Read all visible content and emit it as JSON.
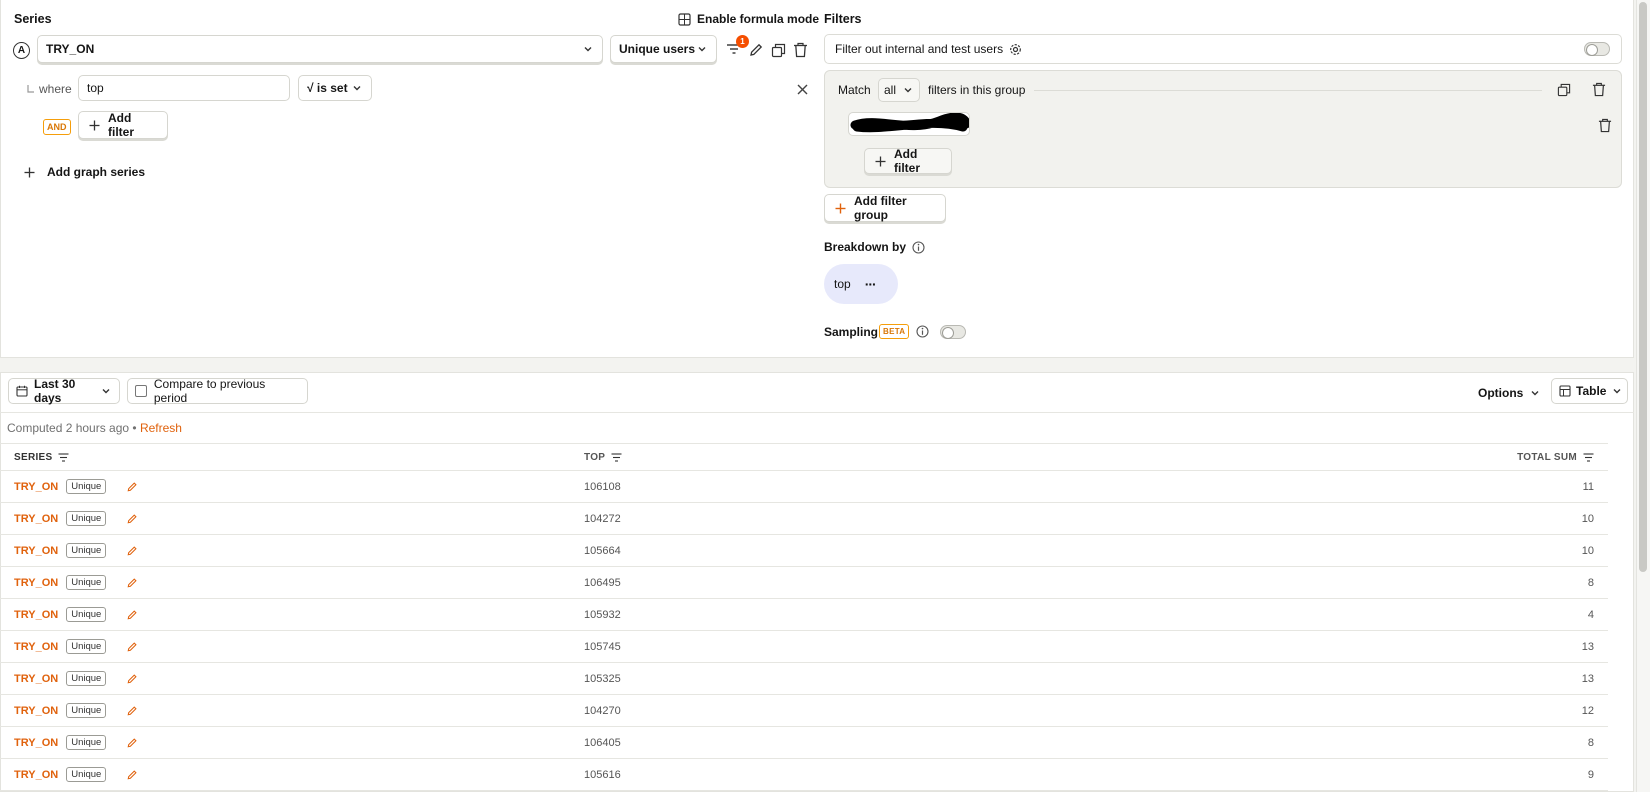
{
  "series_panel": {
    "title": "Series",
    "formula_label": "Enable formula mode",
    "series_letter": "A",
    "event_name": "TRY_ON",
    "aggregation": "Unique users",
    "filter_count_badge": "1",
    "where_label": "where",
    "filter_property": "top",
    "filter_operator": "√ is set",
    "and_badge": "AND",
    "add_filter": "Add filter",
    "add_graph_series": "Add graph series"
  },
  "filters_panel": {
    "title": "Filters",
    "filter_internal_label": "Filter out internal and test users",
    "match_label": "Match",
    "match_value": "all",
    "match_suffix": "filters in this group",
    "add_filter": "Add filter",
    "add_filter_group": "Add filter group",
    "breakdown_title": "Breakdown by",
    "breakdown_value": "top",
    "breakdown_more": "···",
    "sampling_title": "Sampling",
    "sampling_badge": "BETA"
  },
  "results_toolbar": {
    "date_range": "Last 30 days",
    "compare_label": "Compare to previous period",
    "options_label": "Options",
    "view_label": "Table",
    "computed_text": "Computed 2 hours ago • ",
    "refresh_label": "Refresh"
  },
  "table": {
    "headers": {
      "series": "SERIES",
      "top": "TOP",
      "total": "TOTAL SUM"
    },
    "rows": [
      {
        "series": "TRY_ON",
        "tag": "Unique",
        "top": "106108",
        "total": "11"
      },
      {
        "series": "TRY_ON",
        "tag": "Unique",
        "top": "104272",
        "total": "10"
      },
      {
        "series": "TRY_ON",
        "tag": "Unique",
        "top": "105664",
        "total": "10"
      },
      {
        "series": "TRY_ON",
        "tag": "Unique",
        "top": "106495",
        "total": "8"
      },
      {
        "series": "TRY_ON",
        "tag": "Unique",
        "top": "105932",
        "total": "4"
      },
      {
        "series": "TRY_ON",
        "tag": "Unique",
        "top": "105745",
        "total": "13"
      },
      {
        "series": "TRY_ON",
        "tag": "Unique",
        "top": "105325",
        "total": "13"
      },
      {
        "series": "TRY_ON",
        "tag": "Unique",
        "top": "104270",
        "total": "12"
      },
      {
        "series": "TRY_ON",
        "tag": "Unique",
        "top": "106405",
        "total": "8"
      },
      {
        "series": "TRY_ON",
        "tag": "Unique",
        "top": "105616",
        "total": "9"
      }
    ]
  },
  "colors": {
    "accent": "#e0620d",
    "badge": "#f54e00",
    "pill": "#e7e9fb"
  }
}
